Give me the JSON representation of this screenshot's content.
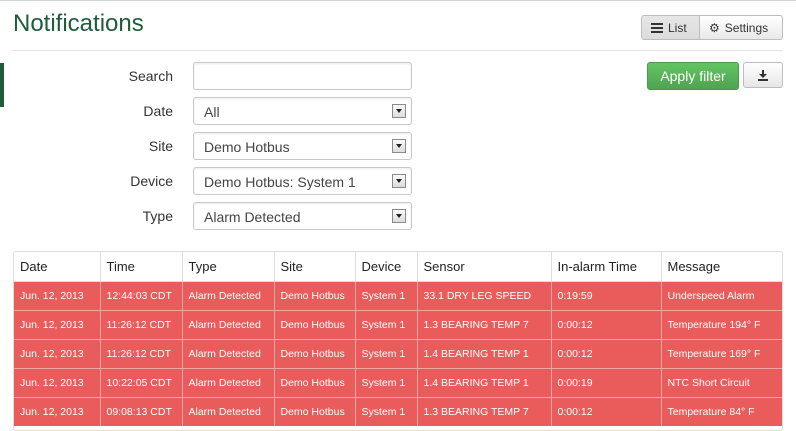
{
  "page": {
    "title": "Notifications"
  },
  "toolbar": {
    "list_label": "List",
    "settings_label": "Settings"
  },
  "filters": {
    "search_label": "Search",
    "search_value": "",
    "date_label": "Date",
    "date_value": "All",
    "site_label": "Site",
    "site_value": "Demo Hotbus",
    "device_label": "Device",
    "device_value": "Demo Hotbus: System 1",
    "type_label": "Type",
    "type_value": "Alarm Detected",
    "apply_label": "Apply filter"
  },
  "colors": {
    "brand": "#1f5c3a",
    "apply": "#51a351",
    "alarm_row": "#ea5b5b"
  },
  "table": {
    "columns": [
      "Date",
      "Time",
      "Type",
      "Site",
      "Device",
      "Sensor",
      "In-alarm Time",
      "Message"
    ],
    "rows": [
      [
        "Jun. 12, 2013",
        "12:44:03 CDT",
        "Alarm Detected",
        "Demo Hotbus",
        "System 1",
        "33.1 DRY LEG SPEED",
        "0:19:59",
        "Underspeed Alarm"
      ],
      [
        "Jun. 12, 2013",
        "11:26:12 CDT",
        "Alarm Detected",
        "Demo Hotbus",
        "System 1",
        "1.3 BEARING TEMP 7",
        "0:00:12",
        "Temperature 194° F"
      ],
      [
        "Jun. 12, 2013",
        "11:26:12 CDT",
        "Alarm Detected",
        "Demo Hotbus",
        "System 1",
        "1.4 BEARING TEMP 1",
        "0:00:12",
        "Temperature 169° F"
      ],
      [
        "Jun. 12, 2013",
        "10:22:05 CDT",
        "Alarm Detected",
        "Demo Hotbus",
        "System 1",
        "1.4 BEARING TEMP 1",
        "0:00:19",
        "NTC Short Circuit"
      ],
      [
        "Jun. 12, 2013",
        "09:08:13 CDT",
        "Alarm Detected",
        "Demo Hotbus",
        "System 1",
        "1.3 BEARING TEMP 7",
        "0:00:12",
        "Temperature 84° F"
      ]
    ]
  }
}
